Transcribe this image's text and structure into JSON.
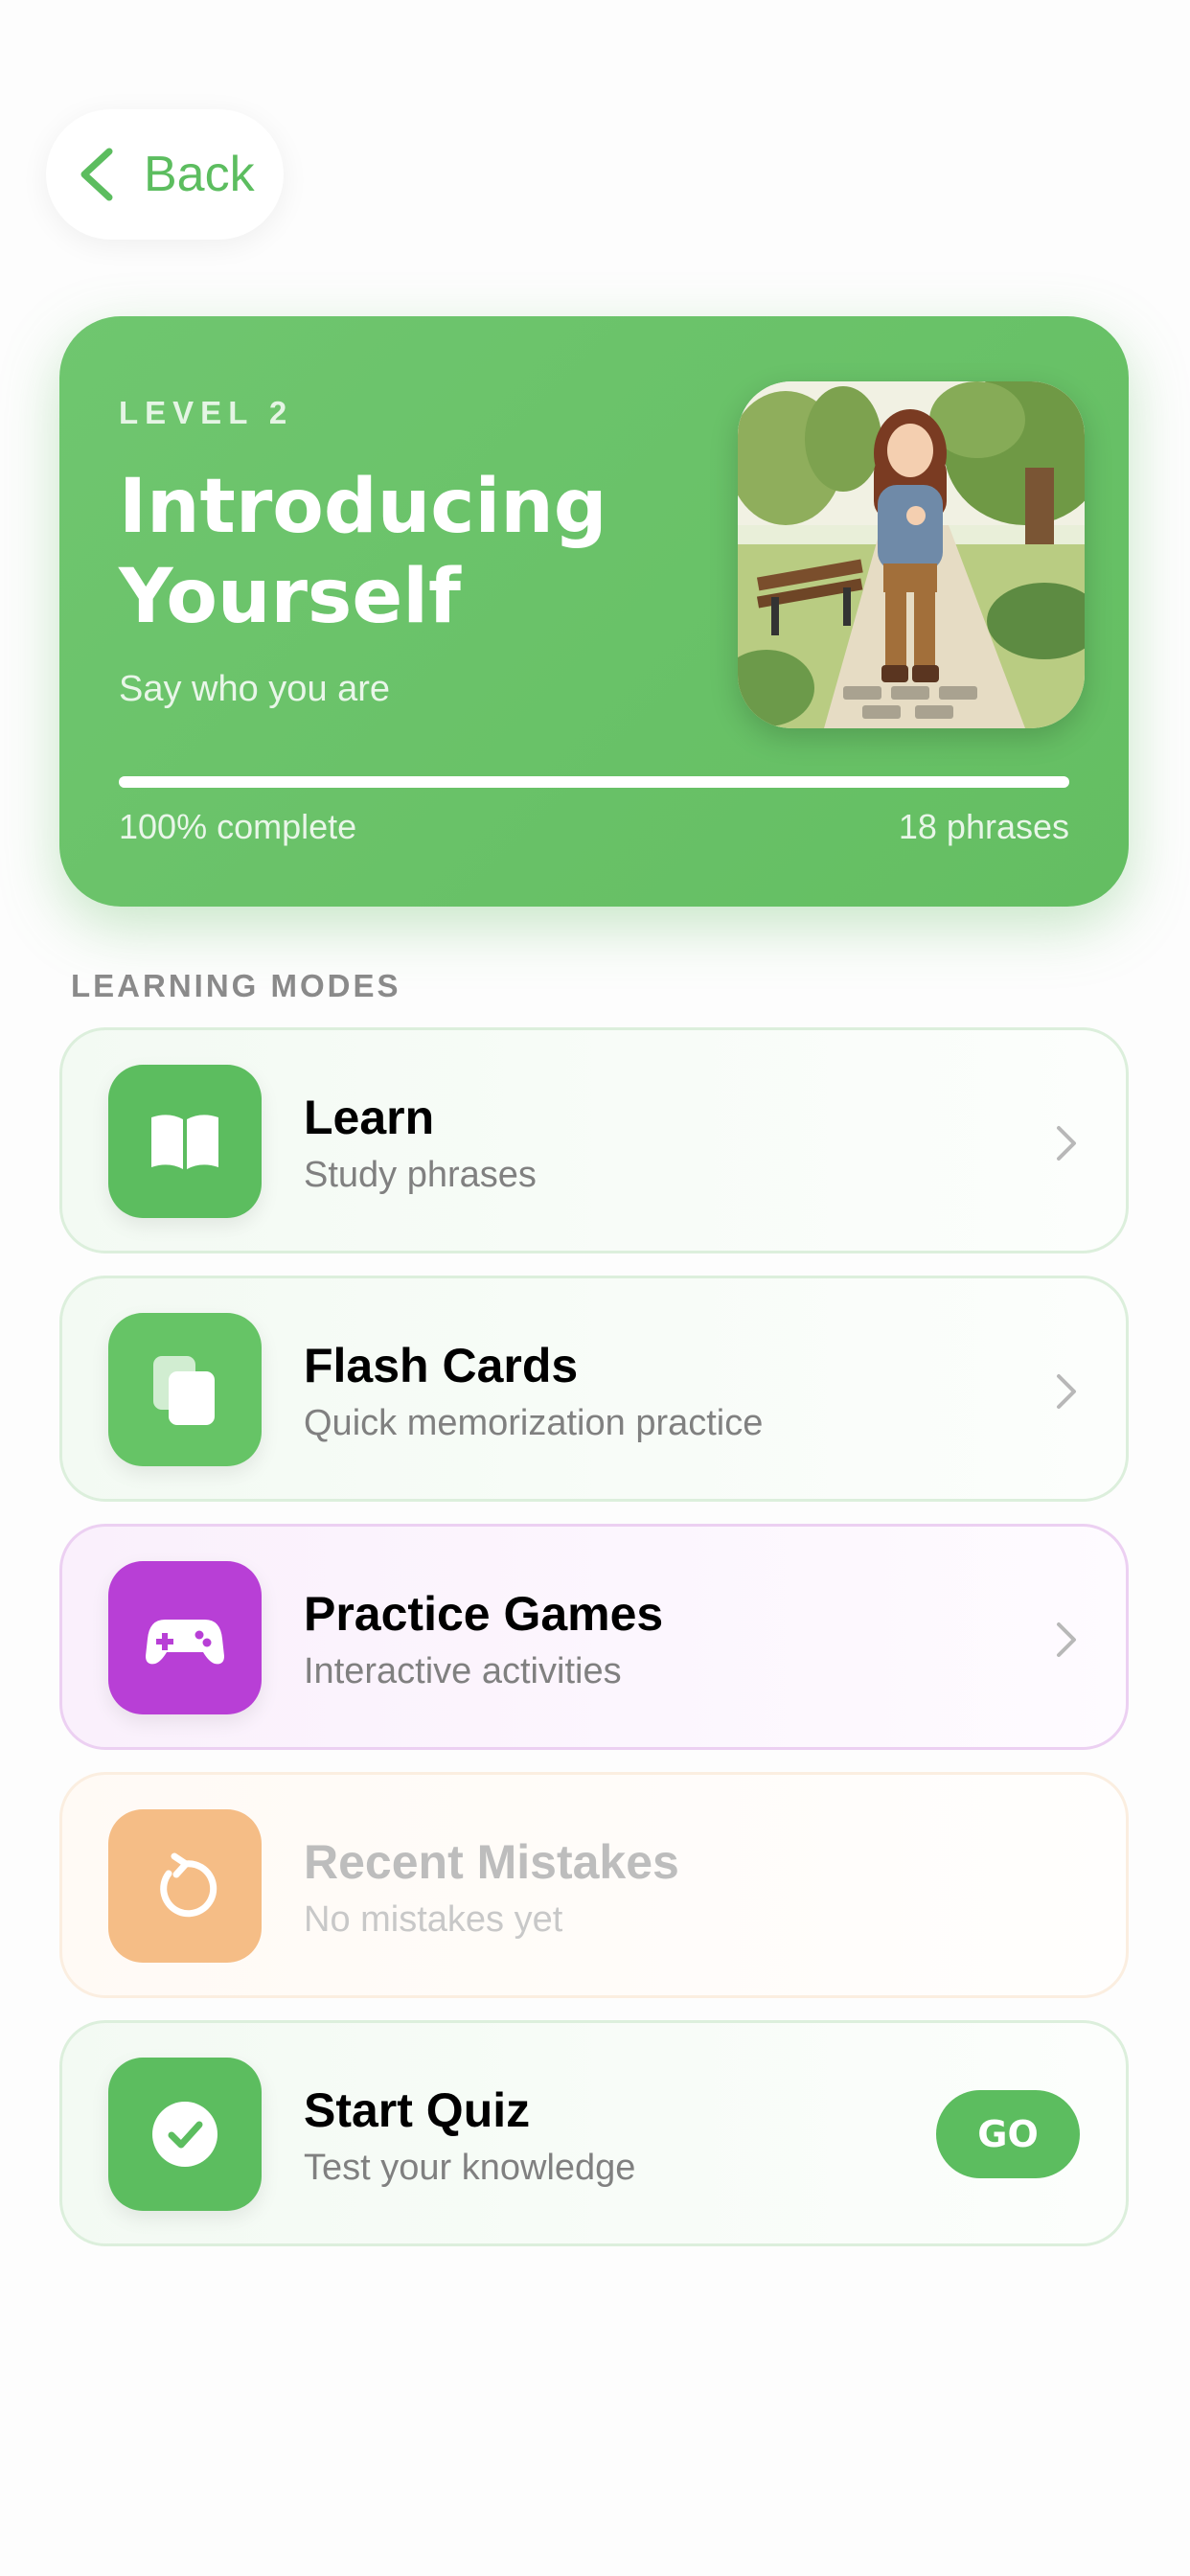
{
  "nav": {
    "back_label": "Back"
  },
  "hero": {
    "level": "LEVEL 2",
    "title": "Introducing Yourself",
    "subtitle": "Say who you are",
    "progress_text": "100% complete",
    "progress_fraction": 1.0,
    "phrases_text": "18 phrases",
    "accent_color": "#66c064"
  },
  "section": {
    "title": "LEARNING MODES"
  },
  "modes": [
    {
      "title": "Learn",
      "subtitle": "Study phrases",
      "icon": "open-book-icon",
      "color": "#5cbd5f"
    },
    {
      "title": "Flash Cards",
      "subtitle": "Quick memorization practice",
      "icon": "cards-icon",
      "color": "#66c466"
    },
    {
      "title": "Practice Games",
      "subtitle": "Interactive activities",
      "icon": "gamepad-icon",
      "color": "#b83fd6"
    },
    {
      "title": "Recent Mistakes",
      "subtitle": "No mistakes yet",
      "icon": "retry-icon",
      "color": "#f5bd86",
      "disabled": true
    },
    {
      "title": "Start Quiz",
      "subtitle": "Test your knowledge",
      "icon": "check-circle-icon",
      "color": "#5cbd5f",
      "action_label": "GO"
    }
  ]
}
